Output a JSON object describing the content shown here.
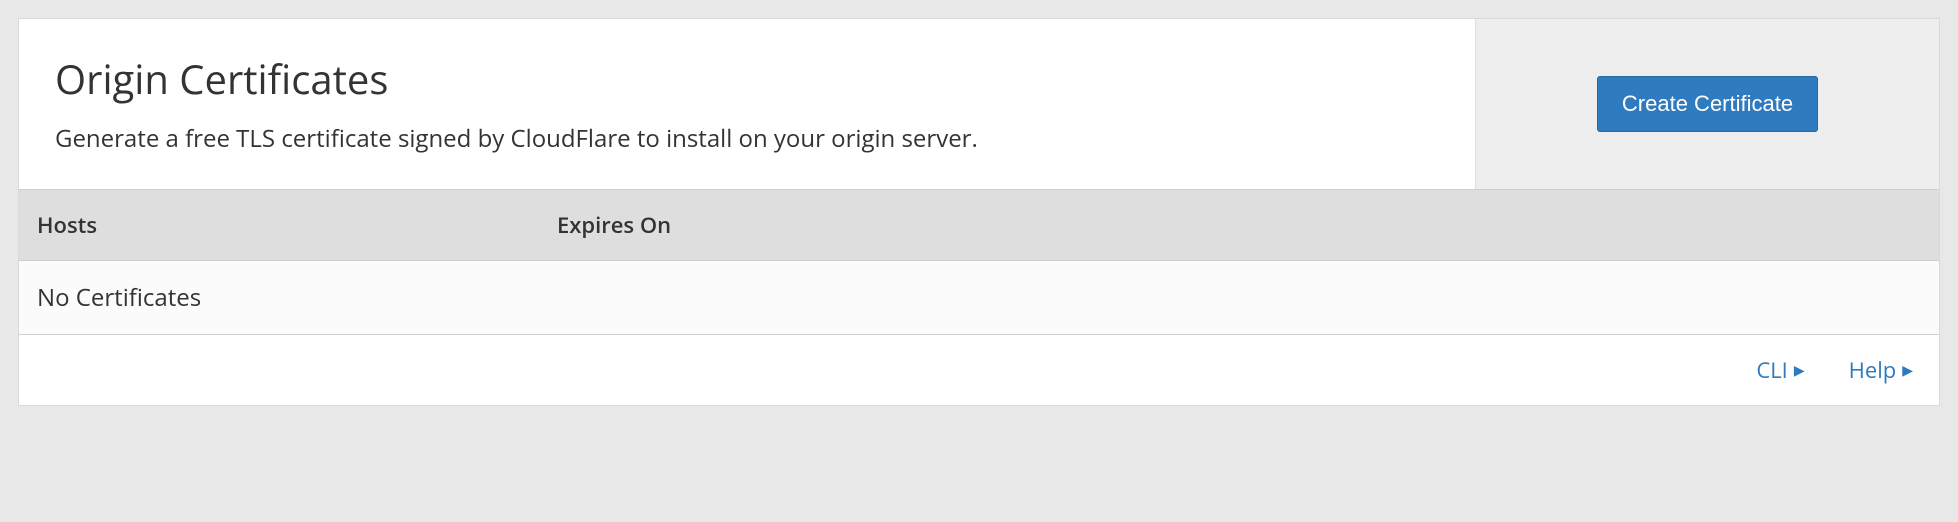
{
  "header": {
    "title": "Origin Certificates",
    "description": "Generate a free TLS certificate signed by CloudFlare to install on your origin server.",
    "action_label": "Create Certificate"
  },
  "table": {
    "columns": {
      "hosts": "Hosts",
      "expires_on": "Expires On"
    },
    "empty_message": "No Certificates"
  },
  "footer": {
    "cli_label": "CLI",
    "help_label": "Help"
  }
}
